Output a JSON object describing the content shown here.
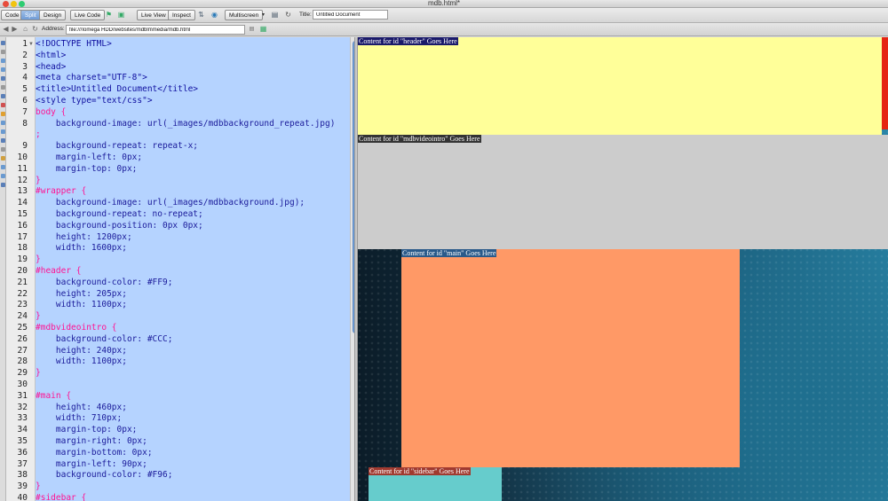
{
  "window": {
    "title": "mdb.html*"
  },
  "toolbar": {
    "code_label": "Code",
    "split_label": "Split",
    "design_label": "Design",
    "live_code_label": "Live Code",
    "live_view_label": "Live View",
    "inspect_label": "Inspect",
    "multiscreen_label": "Multiscreen",
    "title_label": "Title:",
    "title_value": "Untitled Document"
  },
  "addressbar": {
    "label": "Address:",
    "value": "file:///Iomega HDD/websites/mdblmmedia/mdb.html"
  },
  "code": {
    "lines": [
      {
        "n": "1",
        "parts": [
          [
            "tag",
            "<!DOCTYPE HTML>"
          ]
        ]
      },
      {
        "n": "2",
        "parts": [
          [
            "tag",
            "<html>"
          ]
        ]
      },
      {
        "n": "3",
        "parts": [
          [
            "tag",
            "<head>"
          ]
        ]
      },
      {
        "n": "4",
        "parts": [
          [
            "tag",
            "<meta charset=\"UTF-8\">"
          ]
        ]
      },
      {
        "n": "5",
        "parts": [
          [
            "tag",
            "<title>Untitled Document</title>"
          ]
        ]
      },
      {
        "n": "6",
        "parts": [
          [
            "tag",
            "<style type=\"text/css\">"
          ]
        ]
      },
      {
        "n": "7",
        "parts": [
          [
            "sel",
            "body {"
          ]
        ]
      },
      {
        "n": "8",
        "parts": [
          [
            "prop",
            "    background-image: url(_images/mdbbackground_repeat.jpg)"
          ]
        ]
      },
      {
        "n": "",
        "parts": [
          [
            "sel",
            ";"
          ]
        ]
      },
      {
        "n": "9",
        "parts": [
          [
            "prop",
            "    background-repeat: repeat-x;"
          ]
        ]
      },
      {
        "n": "10",
        "parts": [
          [
            "prop",
            "    margin-left: 0px;"
          ]
        ]
      },
      {
        "n": "11",
        "parts": [
          [
            "prop",
            "    margin-top: 0px;"
          ]
        ]
      },
      {
        "n": "12",
        "parts": [
          [
            "sel",
            "}"
          ]
        ]
      },
      {
        "n": "13",
        "parts": [
          [
            "sel",
            "#wrapper {"
          ]
        ]
      },
      {
        "n": "14",
        "parts": [
          [
            "prop",
            "    background-image: url(_images/mdbbackground.jpg);"
          ]
        ]
      },
      {
        "n": "15",
        "parts": [
          [
            "prop",
            "    background-repeat: no-repeat;"
          ]
        ]
      },
      {
        "n": "16",
        "parts": [
          [
            "prop",
            "    background-position: 0px 0px;"
          ]
        ]
      },
      {
        "n": "17",
        "parts": [
          [
            "prop",
            "    height: 1200px;"
          ]
        ]
      },
      {
        "n": "18",
        "parts": [
          [
            "prop",
            "    width: 1600px;"
          ]
        ]
      },
      {
        "n": "19",
        "parts": [
          [
            "sel",
            "}"
          ]
        ]
      },
      {
        "n": "20",
        "parts": [
          [
            "sel",
            "#header {"
          ]
        ]
      },
      {
        "n": "21",
        "parts": [
          [
            "prop",
            "    background-color: #FF9;"
          ]
        ]
      },
      {
        "n": "22",
        "parts": [
          [
            "prop",
            "    height: 205px;"
          ]
        ]
      },
      {
        "n": "23",
        "parts": [
          [
            "prop",
            "    width: 1100px;"
          ]
        ]
      },
      {
        "n": "24",
        "parts": [
          [
            "sel",
            "}"
          ]
        ]
      },
      {
        "n": "25",
        "parts": [
          [
            "sel",
            "#mdbvideointro {"
          ]
        ]
      },
      {
        "n": "26",
        "parts": [
          [
            "prop",
            "    background-color: #CCC;"
          ]
        ]
      },
      {
        "n": "27",
        "parts": [
          [
            "prop",
            "    height: 240px;"
          ]
        ]
      },
      {
        "n": "28",
        "parts": [
          [
            "prop",
            "    width: 1100px;"
          ]
        ]
      },
      {
        "n": "29",
        "parts": [
          [
            "sel",
            "}"
          ]
        ]
      },
      {
        "n": "30",
        "parts": [
          [
            "prop",
            ""
          ]
        ]
      },
      {
        "n": "31",
        "parts": [
          [
            "sel",
            "#main {"
          ]
        ]
      },
      {
        "n": "32",
        "parts": [
          [
            "prop",
            "    height: 460px;"
          ]
        ]
      },
      {
        "n": "33",
        "parts": [
          [
            "prop",
            "    width: 710px;"
          ]
        ]
      },
      {
        "n": "34",
        "parts": [
          [
            "prop",
            "    margin-top: 0px;"
          ]
        ]
      },
      {
        "n": "35",
        "parts": [
          [
            "prop",
            "    margin-right: 0px;"
          ]
        ]
      },
      {
        "n": "36",
        "parts": [
          [
            "prop",
            "    margin-bottom: 0px;"
          ]
        ]
      },
      {
        "n": "37",
        "parts": [
          [
            "prop",
            "    margin-left: 90px;"
          ]
        ]
      },
      {
        "n": "38",
        "parts": [
          [
            "prop",
            "    background-color: #F96;"
          ]
        ]
      },
      {
        "n": "39",
        "parts": [
          [
            "sel",
            "}"
          ]
        ]
      },
      {
        "n": "40",
        "parts": [
          [
            "sel",
            "#sidebar {"
          ]
        ]
      }
    ]
  },
  "design": {
    "header_label": "Content for id \"header\" Goes Here",
    "video_label": "Content for id \"mdbvideointro\" Goes Here",
    "main_label": "Content for id \"main\" Goes Here",
    "sidebar_label": "Content for id \"sidebar\" Goes Here",
    "colors": {
      "header": "#FFFF99",
      "video": "#CCCCCC",
      "main": "#FF9966",
      "sidebar": "#66CCCC"
    }
  }
}
